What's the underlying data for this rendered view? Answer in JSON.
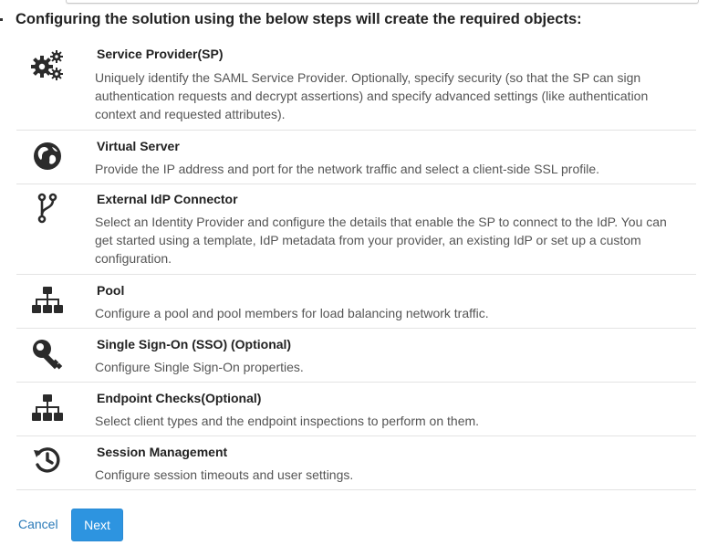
{
  "heading": "Configuring the solution using the below steps will create the required objects:",
  "steps": [
    {
      "icon": "gears-icon",
      "title": "Service Provider(SP)",
      "description": "Uniquely identify the SAML Service Provider. Optionally, specify security (so that the SP can sign authentication requests and decrypt assertions) and specify advanced settings (like authentication context and requested attributes)."
    },
    {
      "icon": "globe-icon",
      "title": "Virtual Server",
      "description": "Provide the IP address and port for the network traffic and select a client-side SSL profile."
    },
    {
      "icon": "connector-branch-icon",
      "title": "External IdP Connector",
      "description": "Select an Identity Provider and configure the details that enable the SP to connect to the IdP. You can get started using a template, IdP metadata from your provider, an existing IdP or set up a custom configuration."
    },
    {
      "icon": "sitemap-icon",
      "title": "Pool",
      "description": "Configure a pool and pool members for load balancing network traffic."
    },
    {
      "icon": "key-icon",
      "title": "Single Sign-On (SSO) (Optional)",
      "description": "Configure Single Sign-On properties."
    },
    {
      "icon": "sitemap-icon",
      "title": "Endpoint Checks(Optional)",
      "description": "Select client types and the endpoint inspections to perform on them."
    },
    {
      "icon": "history-icon",
      "title": "Session Management",
      "description": "Configure session timeouts and user settings."
    }
  ],
  "footer": {
    "cancel_label": "Cancel",
    "next_label": "Next"
  },
  "colors": {
    "link": "#2a7ab8",
    "primary_button": "#2d94e0",
    "divider": "#e3e3e3",
    "icon": "#2b2b2b"
  }
}
